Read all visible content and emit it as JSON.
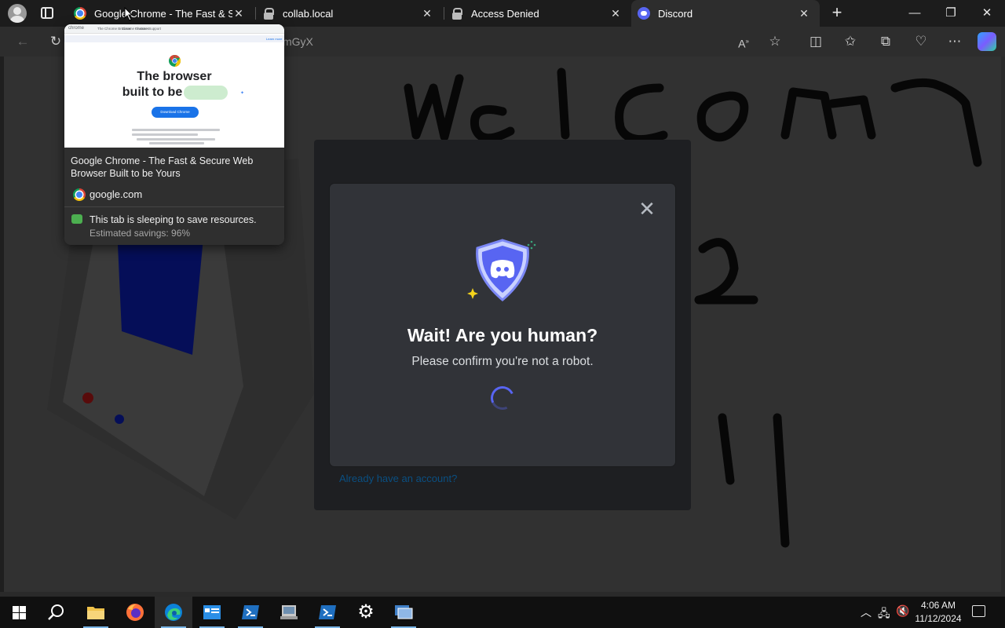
{
  "tabs": [
    {
      "title": "Google Chrome - The Fast & Secure Web Browser Built to be Yours",
      "favicon": "chrome-icon"
    },
    {
      "title": "collab.local",
      "favicon": "lock-icon"
    },
    {
      "title": "Access Denied",
      "favicon": "lock-icon"
    },
    {
      "title": "Discord",
      "favicon": "discord-icon",
      "active": true
    }
  ],
  "address_bar": {
    "visible_fragment": "mGyX"
  },
  "hover_card": {
    "page_title": "Google Chrome - The Fast & Secure Web Browser Built to be Yours",
    "domain": "google.com",
    "sleep_message": "This tab is sleeping to save resources.",
    "savings": "Estimated savings: 96%",
    "preview": {
      "brand": "chrome",
      "nav_links": [
        "The Chrome Browser",
        "Chrome Features",
        "Chrome Support"
      ],
      "headline_line1": "The browser",
      "headline_line2": "built to be",
      "download_label": "Download Chrome",
      "sign_in": "Learn more"
    }
  },
  "modal": {
    "title": "Wait! Are you human?",
    "subtitle": "Please confirm you're not a robot.",
    "close_label": "✕"
  },
  "background_page": {
    "login_link": "Already have an account?"
  },
  "taskbar": {
    "time": "4:06 AM",
    "date": "11/12/2024"
  },
  "colors": {
    "discord_blurple": "#5865f2",
    "modal_bg": "#313338",
    "card_bg": "#1e1f22"
  }
}
